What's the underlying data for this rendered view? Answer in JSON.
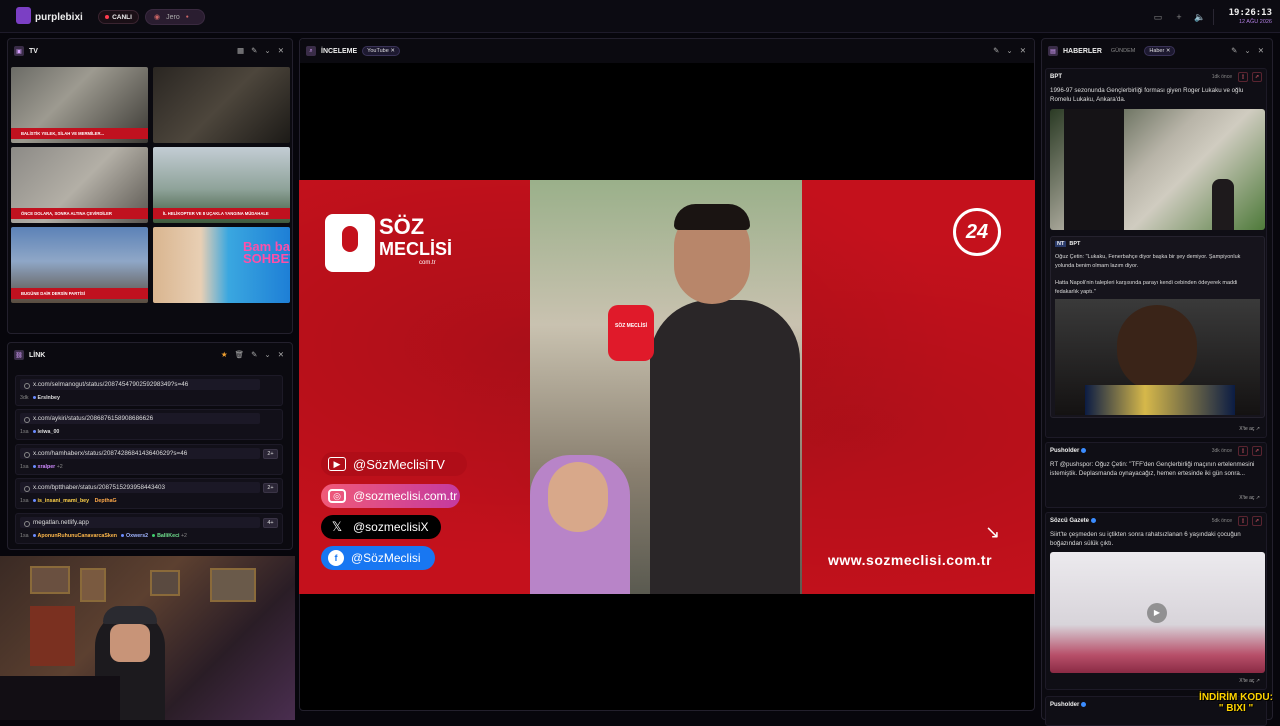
{
  "topbar": {
    "brand": "purplebixi",
    "live": "CANLI",
    "user": "Jero",
    "time": "19:26:13",
    "date": "12 AĞU 2026"
  },
  "tv": {
    "title": "TV",
    "thumbs": [
      {
        "ticker": "BALİSTİK YELEK, SİLAH VE MERMİLER..."
      },
      {
        "ticker": ""
      },
      {
        "ticker": "ÖNCE DOLARA, SONRA ALTINA ÇEVİRDİLER"
      },
      {
        "ticker": "İL HELİKOPTER VE 8 UÇAKLA YANGINA MÜDAHALE"
      },
      {
        "ticker": "BUGÜNE DAİR DERSİN PARTİSİ"
      },
      {
        "ticker": "Bam başka SOHBETLER"
      }
    ]
  },
  "link": {
    "title": "LİNK",
    "rows": [
      {
        "url": "x.com/selmanogut/status/2087454790259298349?s=46",
        "age": "3dk",
        "users": [
          "Erslnbey"
        ],
        "count": ""
      },
      {
        "url": "x.com/aykiri/status/2086876158908686626",
        "age": "1sa",
        "users": [
          "leiwa_00"
        ],
        "count": ""
      },
      {
        "url": "x.com/hamhaberx/status/2087428684143640629?s=46",
        "age": "1sa",
        "users": [
          "xralper",
          "+2"
        ],
        "count": "2+"
      },
      {
        "url": "x.com/bptthaber/status/2087515293958443403",
        "age": "1sa",
        "users": [
          "is_insani_mami_bey",
          "DepthaG"
        ],
        "count": "2+"
      },
      {
        "url": "megatlan.netlify.app",
        "age": "1sa",
        "users": [
          "AponunRuhunuCanavarcaSken",
          "Oxwers2",
          "BalliKeci",
          "+2"
        ],
        "count": "4+"
      }
    ]
  },
  "inceleme": {
    "title": "İNCELEME",
    "tag": "YouTube"
  },
  "video": {
    "brand_line1": "SÖZ",
    "brand_line2": "MECLİSİ",
    "brand_sub": "com.tr",
    "badge": "24",
    "youtube": "@SözMeclisiTV",
    "instagram": "@sozmeclisi.com.tr",
    "x": "@sozmeclisiX",
    "facebook": "@SözMeclisi",
    "website": "www.sozmeclisi.com.tr",
    "mic_label": "SÖZ MECLİSİ"
  },
  "haberler": {
    "title": "HABERLER",
    "tab1": "GÜNDEM",
    "tab2": "Haber",
    "open_label": "X'te aç",
    "cards": [
      {
        "source": "BPT",
        "time": "1dk önce",
        "text": "1996-97 sezonunda Gençlerbirliği forması giyen Roger Lukaku ve oğlu Romelu Lukaku, Ankara'da.",
        "quote_source": "BPT",
        "quote_text": "Oğuz Çetin: \"Lukaku, Fenerbahçe diyor başka bir şey demiyor. Şampiyonluk yolunda benim olmam lazım diyor.",
        "quote_text2": "Hatta Napoli'nin talepleri karşısında parayı kendi cebinden ödeyerek maddi fedakarlık yaptı.\""
      },
      {
        "source": "Pusholder",
        "time": "3dk önce",
        "text": "RT @pushspor: Oğuz Çetin: \"TFF'den Gençlerbirliği maçının ertelenmesini istemiştik. Deplasmanda oynayacağız, hemen ertesinde iki gün sonra..."
      },
      {
        "source": "Sözcü Gazete",
        "time": "5dk önce",
        "text": "Siirt'te çeşmeden su içtikten sonra rahatsızlanan 6 yaşındaki çocuğun boğazından sülük çıktı."
      },
      {
        "source": "Pusholder",
        "time": "",
        "text": ""
      }
    ]
  },
  "promo": {
    "line1": "İNDİRİM KODU:",
    "line2": "\" BIXI \""
  }
}
